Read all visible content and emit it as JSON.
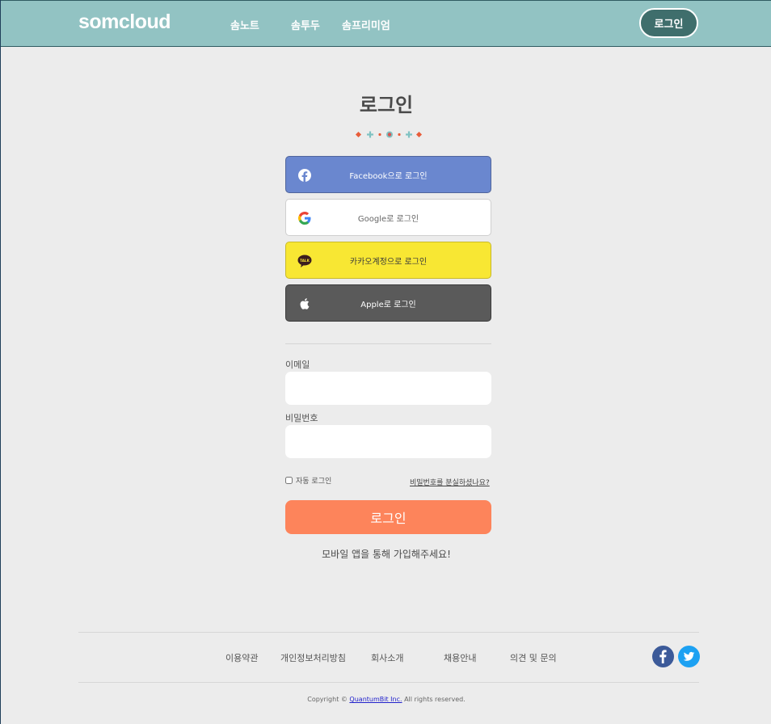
{
  "header": {
    "logo": "somcloud",
    "nav": [
      "솜노트",
      "솜투두",
      "솜프리미엄"
    ],
    "login_button": "로그인"
  },
  "main": {
    "title": "로그인",
    "social": {
      "facebook": "Facebook으로 로그인",
      "google": "Google로 로그인",
      "kakao": "카카오계정으로 로그인",
      "kakao_icon_text": "TALK",
      "apple": "Apple로 로그인"
    },
    "email_label": "이메일",
    "email_value": "",
    "password_label": "비밀번호",
    "password_value": "",
    "auto_login": "자동 로그인",
    "forgot_password": "비밀번호를 분실하셨나요?",
    "submit": "로그인",
    "signup_note": "모바일 앱을 통해 가입해주세요!"
  },
  "footer": {
    "links": [
      "이용약관",
      "개인정보처리방침",
      "회사소개",
      "채용안내",
      "의견 및 문의"
    ],
    "copyright_prefix": "Copyright ©",
    "company": "QuantumBit Inc.",
    "copyright_suffix": "All rights reserved."
  },
  "colors": {
    "header_bg": "#92c3c3",
    "facebook": "#6a87cf",
    "kakao": "#f8e733",
    "apple": "#5a5a5a",
    "submit": "#fd845b",
    "facebook_circle": "#3c5a99",
    "twitter_circle": "#1da1f2"
  }
}
